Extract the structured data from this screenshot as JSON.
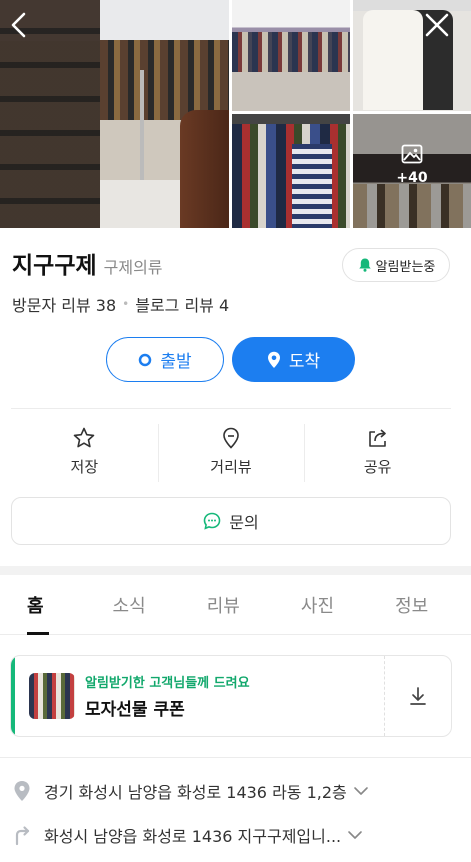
{
  "gallery": {
    "more_count": "+40"
  },
  "place": {
    "name": "지구구제",
    "category": "구제의류",
    "notify_label": "알림받는중"
  },
  "reviews": {
    "visitor": "방문자 리뷰 38",
    "blog": "블로그 리뷰 4"
  },
  "route": {
    "start_label": "출발",
    "arrive_label": "도착"
  },
  "actions": [
    {
      "label": "저장"
    },
    {
      "label": "거리뷰"
    },
    {
      "label": "공유"
    }
  ],
  "inquiry": {
    "label": "문의"
  },
  "tabs": [
    {
      "label": "홈",
      "active": true
    },
    {
      "label": "소식"
    },
    {
      "label": "리뷰"
    },
    {
      "label": "사진"
    },
    {
      "label": "정보"
    }
  ],
  "coupon": {
    "subtitle": "알림받기한 고객님들께 드려요",
    "title": "모자선물 쿠폰"
  },
  "info": {
    "address": "경기 화성시 남양읍 화성로 1436 라동 1,2층",
    "description": "화성시 남양읍 화성로 1436 지구구제입니..."
  },
  "colors": {
    "accent": "#1c7ef0",
    "coupon_green": "#16b87a",
    "notify_green": "#16b87a"
  }
}
